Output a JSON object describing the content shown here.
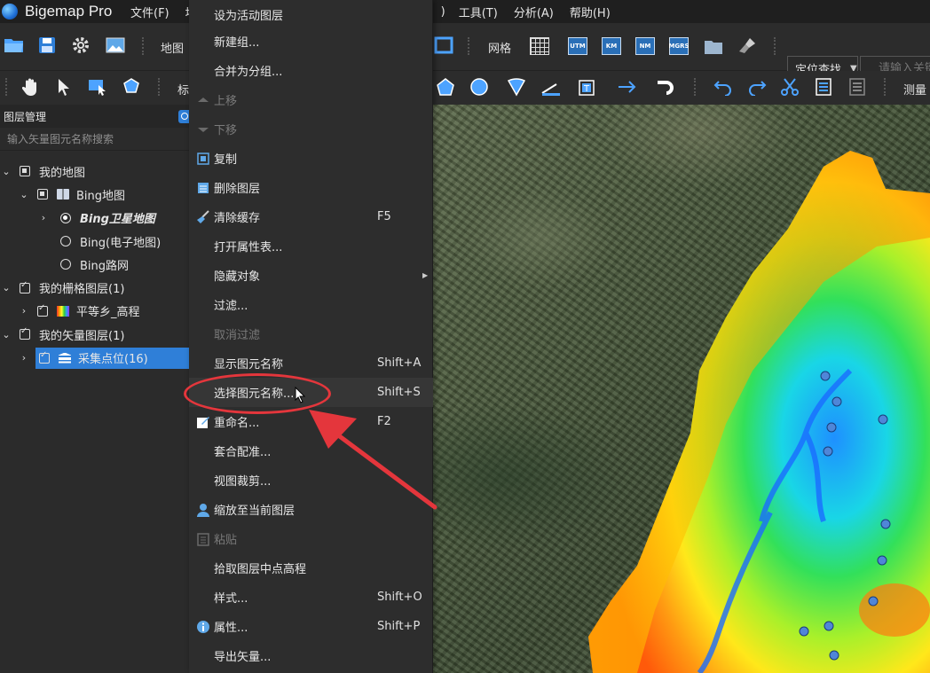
{
  "app": {
    "title": "Bigemap Pro"
  },
  "menubar": {
    "left_items": [
      "文件(F)",
      "地"
    ],
    "right_items": [
      ")",
      "工具(T)",
      "分析(A)",
      "帮助(H)"
    ]
  },
  "toolbar1": {
    "map_label": "地图",
    "grid_label": "网格",
    "locate_label": "定位查找",
    "search_placeholder": "请输入关键"
  },
  "toolbar2": {
    "mark_label": "标",
    "measure_label": "测量"
  },
  "layer_panel": {
    "title": "图层管理",
    "filter_placeholder": "输入矢量图元名称搜索",
    "tree": [
      {
        "label": "我的地图"
      },
      {
        "label": "Bing地图"
      },
      {
        "label": "Bing卫星地图"
      },
      {
        "label": "Bing(电子地图)"
      },
      {
        "label": "Bing路网"
      },
      {
        "label": "我的栅格图层(1)"
      },
      {
        "label": "平等乡_高程"
      },
      {
        "label": "我的矢量图层(1)"
      },
      {
        "label": "采集点位(16)"
      }
    ]
  },
  "context_menu": {
    "items": [
      {
        "label": "设为活动图层",
        "shortcut": "",
        "disabled": false
      },
      {
        "label": "新建组...",
        "shortcut": "",
        "disabled": false
      },
      {
        "label": "合并为分组...",
        "shortcut": "",
        "disabled": false
      },
      {
        "label": "上移",
        "shortcut": "",
        "disabled": true
      },
      {
        "label": "下移",
        "shortcut": "",
        "disabled": true
      },
      {
        "label": "复制",
        "shortcut": "",
        "disabled": false
      },
      {
        "label": "删除图层",
        "shortcut": "",
        "disabled": false
      },
      {
        "label": "清除缓存",
        "shortcut": "F5",
        "disabled": false
      },
      {
        "label": "打开属性表...",
        "shortcut": "",
        "disabled": false
      },
      {
        "label": "隐藏对象",
        "shortcut": "",
        "disabled": false
      },
      {
        "label": "过滤...",
        "shortcut": "",
        "disabled": false
      },
      {
        "label": "取消过滤",
        "shortcut": "",
        "disabled": true
      },
      {
        "label": "显示图元名称",
        "shortcut": "Shift+A",
        "disabled": false
      },
      {
        "label": "选择图元名称...",
        "shortcut": "Shift+S",
        "disabled": false
      },
      {
        "label": "重命名...",
        "shortcut": "F2",
        "disabled": false
      },
      {
        "label": "套合配准...",
        "shortcut": "",
        "disabled": false
      },
      {
        "label": "视图裁剪...",
        "shortcut": "",
        "disabled": false
      },
      {
        "label": "缩放至当前图层",
        "shortcut": "",
        "disabled": false
      },
      {
        "label": "粘贴",
        "shortcut": "",
        "disabled": true
      },
      {
        "label": "拾取图层中点高程",
        "shortcut": "",
        "disabled": false
      },
      {
        "label": "样式...",
        "shortcut": "Shift+O",
        "disabled": false
      },
      {
        "label": "属性...",
        "shortcut": "Shift+P",
        "disabled": false
      },
      {
        "label": "导出矢量...",
        "shortcut": "",
        "disabled": false
      }
    ]
  },
  "annotation": {
    "color": "#e4363c"
  },
  "colors": {
    "accent": "#2f7fd8",
    "point": "#4f86d8"
  }
}
